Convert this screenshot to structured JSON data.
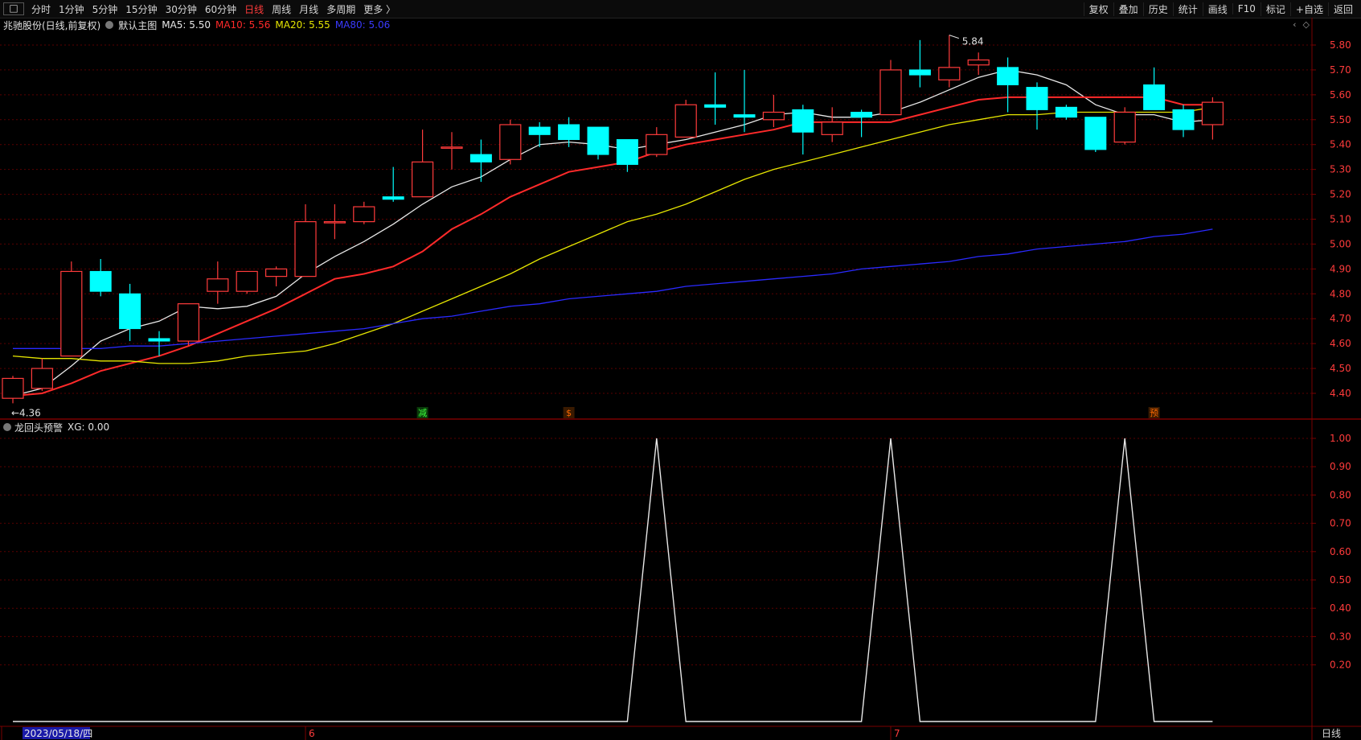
{
  "toolbar": {
    "periods": [
      "分时",
      "1分钟",
      "5分钟",
      "15分钟",
      "30分钟",
      "60分钟",
      "日线",
      "周线",
      "月线",
      "多周期",
      "更多 〉"
    ],
    "active_period": "日线",
    "tools": [
      "复权",
      "叠加",
      "历史",
      "统计",
      "画线",
      "F10",
      "标记",
      "+自选",
      "返回"
    ]
  },
  "header": {
    "stock_name": "兆驰股份(日线,前复权)",
    "main_chart_label": "默认主图",
    "ma5_label": "MA5: 5.50",
    "ma10_label": "MA10: 5.56",
    "ma20_label": "MA20: 5.55",
    "ma80_label": "MA80: 5.06"
  },
  "indicator": {
    "label": "龙回头预警",
    "value_label": "XG: 0.00"
  },
  "colors": {
    "up": "#ff3b3b",
    "down": "#00ffff",
    "ma5": "#e8e8e8",
    "ma10": "#ff2a2a",
    "ma20": "#e6e600",
    "ma80": "#2a2aff",
    "grid": "#5a0000",
    "axis_text": "#ff3b3b"
  },
  "chart_data": [
    {
      "type": "candlestick",
      "title": "",
      "ylim": [
        4.34,
        5.86
      ],
      "y_ticks": [
        "4.40",
        "4.50",
        "4.60",
        "4.70",
        "4.80",
        "4.90",
        "5.00",
        "5.10",
        "5.20",
        "5.30",
        "5.40",
        "5.50",
        "5.60",
        "5.70",
        "5.80"
      ],
      "candles": [
        {
          "o": 4.38,
          "c": 4.46,
          "h": 4.47,
          "l": 4.36
        },
        {
          "o": 4.42,
          "c": 4.5,
          "h": 4.54,
          "l": 4.41
        },
        {
          "o": 4.55,
          "c": 4.89,
          "h": 4.93,
          "l": 4.55
        },
        {
          "o": 4.89,
          "c": 4.81,
          "h": 4.94,
          "l": 4.79
        },
        {
          "o": 4.8,
          "c": 4.66,
          "h": 4.84,
          "l": 4.61
        },
        {
          "o": 4.62,
          "c": 4.61,
          "h": 4.65,
          "l": 4.55
        },
        {
          "o": 4.61,
          "c": 4.76,
          "h": 4.76,
          "l": 4.59
        },
        {
          "o": 4.81,
          "c": 4.86,
          "h": 4.93,
          "l": 4.76
        },
        {
          "o": 4.81,
          "c": 4.89,
          "h": 4.89,
          "l": 4.8
        },
        {
          "o": 4.87,
          "c": 4.9,
          "h": 4.91,
          "l": 4.83
        },
        {
          "o": 4.87,
          "c": 5.09,
          "h": 5.16,
          "l": 4.87
        },
        {
          "o": 5.09,
          "c": 5.09,
          "h": 5.16,
          "l": 5.02
        },
        {
          "o": 5.09,
          "c": 5.15,
          "h": 5.17,
          "l": 5.08
        },
        {
          "o": 5.19,
          "c": 5.18,
          "h": 5.31,
          "l": 5.17
        },
        {
          "o": 5.19,
          "c": 5.33,
          "h": 5.46,
          "l": 5.19
        },
        {
          "o": 5.39,
          "c": 5.39,
          "h": 5.45,
          "l": 5.3
        },
        {
          "o": 5.36,
          "c": 5.33,
          "h": 5.42,
          "l": 5.25
        },
        {
          "o": 5.34,
          "c": 5.48,
          "h": 5.5,
          "l": 5.32
        },
        {
          "o": 5.47,
          "c": 5.44,
          "h": 5.49,
          "l": 5.39
        },
        {
          "o": 5.48,
          "c": 5.42,
          "h": 5.51,
          "l": 5.39
        },
        {
          "o": 5.47,
          "c": 5.36,
          "h": 5.47,
          "l": 5.34
        },
        {
          "o": 5.42,
          "c": 5.32,
          "h": 5.42,
          "l": 5.29
        },
        {
          "o": 5.36,
          "c": 5.44,
          "h": 5.47,
          "l": 5.35
        },
        {
          "o": 5.43,
          "c": 5.56,
          "h": 5.58,
          "l": 5.43
        },
        {
          "o": 5.56,
          "c": 5.55,
          "h": 5.69,
          "l": 5.48
        },
        {
          "o": 5.52,
          "c": 5.51,
          "h": 5.7,
          "l": 5.45
        },
        {
          "o": 5.5,
          "c": 5.53,
          "h": 5.6,
          "l": 5.47
        },
        {
          "o": 5.54,
          "c": 5.45,
          "h": 5.56,
          "l": 5.36
        },
        {
          "o": 5.44,
          "c": 5.49,
          "h": 5.55,
          "l": 5.41
        },
        {
          "o": 5.53,
          "c": 5.51,
          "h": 5.54,
          "l": 5.43
        },
        {
          "o": 5.52,
          "c": 5.7,
          "h": 5.74,
          "l": 5.52
        },
        {
          "o": 5.7,
          "c": 5.68,
          "h": 5.82,
          "l": 5.63
        },
        {
          "o": 5.66,
          "c": 5.71,
          "h": 5.84,
          "l": 5.63
        },
        {
          "o": 5.72,
          "c": 5.74,
          "h": 5.77,
          "l": 5.68
        },
        {
          "o": 5.71,
          "c": 5.64,
          "h": 5.75,
          "l": 5.53
        },
        {
          "o": 5.63,
          "c": 5.54,
          "h": 5.65,
          "l": 5.46
        },
        {
          "o": 5.55,
          "c": 5.51,
          "h": 5.56,
          "l": 5.5
        },
        {
          "o": 5.51,
          "c": 5.38,
          "h": 5.51,
          "l": 5.37
        },
        {
          "o": 5.41,
          "c": 5.53,
          "h": 5.55,
          "l": 5.4
        },
        {
          "o": 5.64,
          "c": 5.54,
          "h": 5.71,
          "l": 5.54
        },
        {
          "o": 5.54,
          "c": 5.46,
          "h": 5.56,
          "l": 5.43
        },
        {
          "o": 5.48,
          "c": 5.57,
          "h": 5.59,
          "l": 5.42
        }
      ],
      "series": [
        {
          "name": "MA5",
          "values": [
            4.39,
            4.42,
            4.51,
            4.61,
            4.66,
            4.69,
            4.75,
            4.74,
            4.75,
            4.79,
            4.88,
            4.95,
            5.01,
            5.08,
            5.16,
            5.23,
            5.27,
            5.34,
            5.4,
            5.41,
            5.4,
            5.38,
            5.4,
            5.42,
            5.45,
            5.48,
            5.52,
            5.53,
            5.51,
            5.51,
            5.53,
            5.57,
            5.62,
            5.67,
            5.7,
            5.68,
            5.64,
            5.56,
            5.52,
            5.52,
            5.49,
            5.5
          ]
        },
        {
          "name": "MA10",
          "values": [
            4.39,
            4.4,
            4.44,
            4.49,
            4.52,
            4.55,
            4.59,
            4.64,
            4.69,
            4.74,
            4.8,
            4.86,
            4.88,
            4.91,
            4.97,
            5.06,
            5.12,
            5.19,
            5.24,
            5.29,
            5.31,
            5.33,
            5.37,
            5.4,
            5.42,
            5.44,
            5.46,
            5.49,
            5.49,
            5.49,
            5.49,
            5.52,
            5.55,
            5.58,
            5.59,
            5.59,
            5.59,
            5.59,
            5.59,
            5.59,
            5.56,
            5.56
          ]
        },
        {
          "name": "MA20",
          "values": [
            4.55,
            4.54,
            4.54,
            4.53,
            4.53,
            4.52,
            4.52,
            4.53,
            4.55,
            4.56,
            4.57,
            4.6,
            4.64,
            4.68,
            4.73,
            4.78,
            4.83,
            4.88,
            4.94,
            4.99,
            5.04,
            5.09,
            5.12,
            5.16,
            5.21,
            5.26,
            5.3,
            5.33,
            5.36,
            5.39,
            5.42,
            5.45,
            5.48,
            5.5,
            5.52,
            5.52,
            5.53,
            5.53,
            5.53,
            5.53,
            5.53,
            5.55
          ]
        },
        {
          "name": "MA80",
          "values": [
            4.58,
            4.58,
            4.58,
            4.58,
            4.59,
            4.59,
            4.6,
            4.61,
            4.62,
            4.63,
            4.64,
            4.65,
            4.66,
            4.68,
            4.7,
            4.71,
            4.73,
            4.75,
            4.76,
            4.78,
            4.79,
            4.8,
            4.81,
            4.83,
            4.84,
            4.85,
            4.86,
            4.87,
            4.88,
            4.9,
            4.91,
            4.92,
            4.93,
            4.95,
            4.96,
            4.98,
            4.99,
            5.0,
            5.01,
            5.03,
            5.04,
            5.06
          ]
        }
      ],
      "annotations": {
        "high": "5.84",
        "low": "4.36"
      },
      "markers": [
        {
          "index": 14,
          "label": "减"
        },
        {
          "index": 19,
          "label": "$"
        },
        {
          "index": 39,
          "label": "预"
        }
      ]
    },
    {
      "type": "line",
      "title": "",
      "ylim": [
        0.0,
        1.0
      ],
      "y_ticks": [
        "0.20",
        "0.30",
        "0.40",
        "0.50",
        "0.60",
        "0.70",
        "0.80",
        "0.90",
        "1.00"
      ],
      "series": [
        {
          "name": "XG",
          "values": [
            0,
            0,
            0,
            0,
            0,
            0,
            0,
            0,
            0,
            0,
            0,
            0,
            0,
            0,
            0,
            0,
            0,
            0,
            0,
            0,
            0,
            0,
            1,
            0,
            0,
            0,
            0,
            0,
            0,
            0,
            1,
            0,
            0,
            0,
            0,
            0,
            0,
            0,
            1,
            0,
            0,
            0
          ]
        }
      ]
    }
  ],
  "x_axis": {
    "labels": [
      {
        "index": 0,
        "text": "2023/05/18/四"
      },
      {
        "index": 10,
        "text": "6"
      },
      {
        "index": 30,
        "text": "7"
      }
    ],
    "timeframe": "日线"
  }
}
